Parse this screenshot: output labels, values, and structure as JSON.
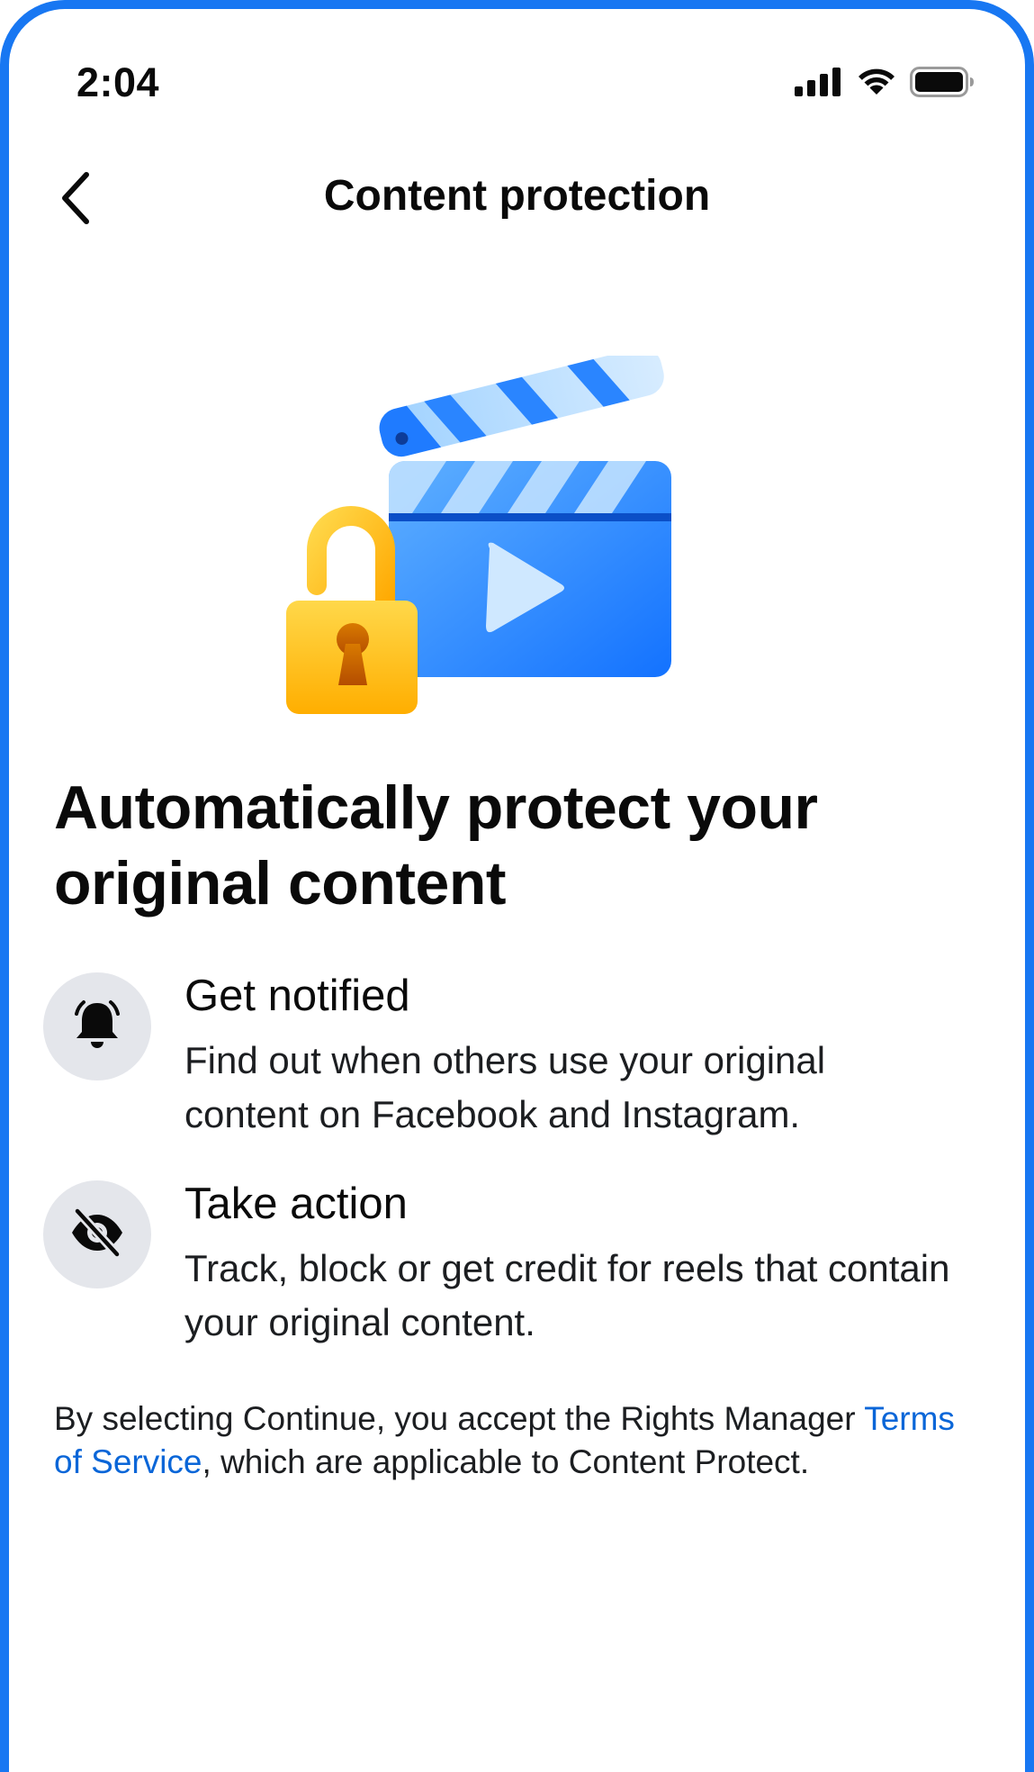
{
  "status_bar": {
    "time": "2:04",
    "icons": [
      "cellular-signal-icon",
      "wifi-icon",
      "battery-icon"
    ]
  },
  "header": {
    "back_icon": "chevron-left-icon",
    "title": "Content protection"
  },
  "hero": {
    "illustration": "clapperboard-with-open-padlock"
  },
  "headline": "Automatically protect your original content",
  "features": [
    {
      "icon": "bell-icon",
      "title": "Get notified",
      "description": "Find out when others use your original content on Facebook and Instagram."
    },
    {
      "icon": "eye-slash-icon",
      "title": "Take action",
      "description": "Track, block or get credit for reels that contain your original content."
    }
  ],
  "legal": {
    "prefix": "By selecting Continue, you accept the Rights Manager ",
    "link_text": "Terms of Service",
    "suffix": ", which are applicable to Content Protect."
  },
  "colors": {
    "frame": "#1877f2",
    "link": "#0a66d8",
    "icon_circle": "#e4e6eb"
  }
}
